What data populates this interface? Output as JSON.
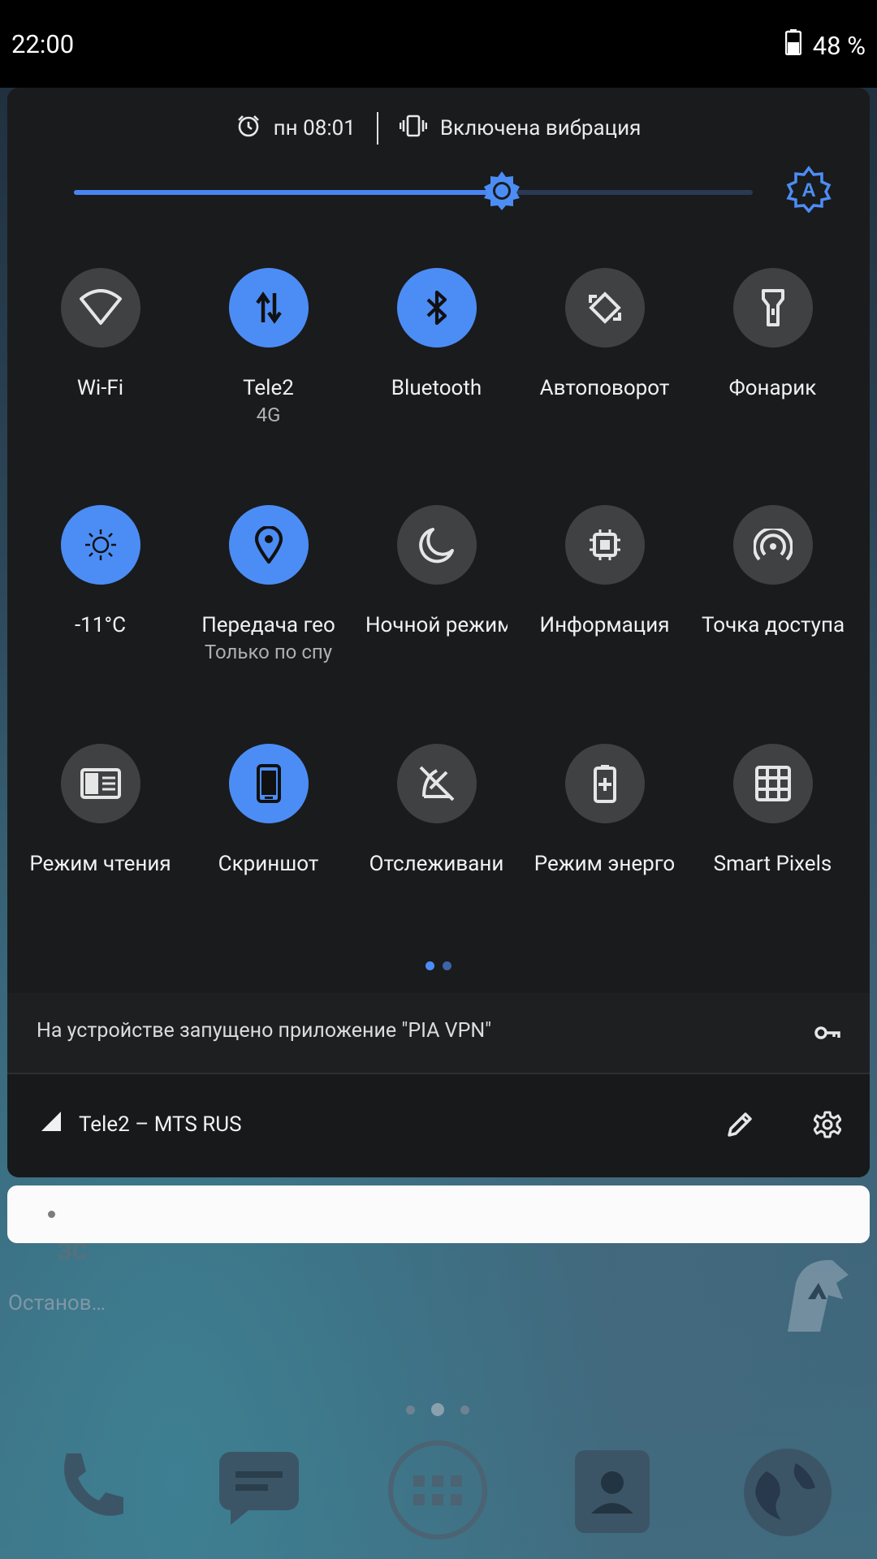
{
  "status_bar": {
    "time": "22:00",
    "battery": "48 %"
  },
  "header": {
    "alarm": "пн 08:01",
    "sound_mode": "Включена вибрация"
  },
  "brightness": {
    "level": 0.63
  },
  "tiles": [
    {
      "label": "Wi-Fi",
      "sub": "",
      "icon": "wifi-icon",
      "on": false
    },
    {
      "label": "Tele2",
      "sub": "4G",
      "icon": "mobile-data-icon",
      "on": true
    },
    {
      "label": "Bluetooth",
      "sub": "",
      "icon": "bluetooth-icon",
      "on": true
    },
    {
      "label": "Автоповорот",
      "sub": "",
      "icon": "auto-rotate-icon",
      "on": false
    },
    {
      "label": "Фонарик",
      "sub": "",
      "icon": "flashlight-icon",
      "on": false
    },
    {
      "label": "-11°C",
      "sub": "",
      "icon": "weather-sun-icon",
      "on": true
    },
    {
      "label": "Передача гео",
      "sub": "Только по спу",
      "icon": "location-icon",
      "on": true
    },
    {
      "label": "Ночной режим",
      "sub": "",
      "icon": "night-mode-icon",
      "on": false
    },
    {
      "label": "Информация",
      "sub": "",
      "icon": "cpu-info-icon",
      "on": false
    },
    {
      "label": "Точка доступа",
      "sub": "",
      "icon": "hotspot-icon",
      "on": false
    },
    {
      "label": "Режим чтения",
      "sub": "",
      "icon": "reading-mode-icon",
      "on": false
    },
    {
      "label": "Скриншот",
      "sub": "",
      "icon": "screenshot-icon",
      "on": true
    },
    {
      "label": "Отслеживани",
      "sub": "",
      "icon": "tracking-off-icon",
      "on": false
    },
    {
      "label": "Режим энерго",
      "sub": "",
      "icon": "battery-saver-icon",
      "on": false
    },
    {
      "label": "Smart Pixels",
      "sub": "",
      "icon": "smart-pixels-icon",
      "on": false
    }
  ],
  "pager": {
    "pages": 2,
    "active": 0
  },
  "vpn": {
    "text": "На устройстве запущено приложение \"PIA VPN\""
  },
  "network": {
    "carrier": "Tele2 – MTS RUS"
  },
  "home": {
    "widget_label": "Останов…",
    "peek_text": "ЗС"
  },
  "colors": {
    "accent": "#4c8df5",
    "tile_off": "#404142",
    "panel": "#1a1b1d"
  }
}
